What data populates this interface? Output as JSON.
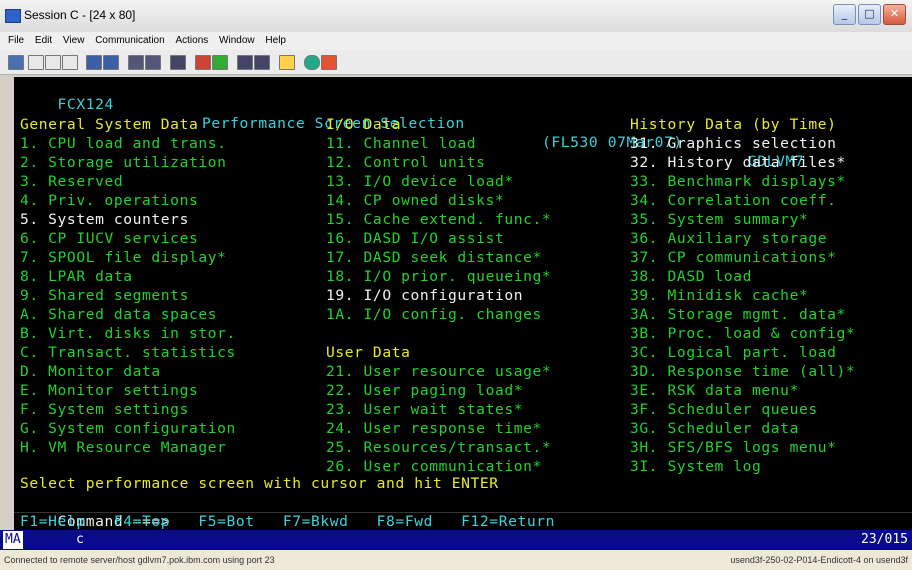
{
  "window": {
    "title": "Session C - [24 x 80]",
    "buttons": [
      "_",
      "□",
      "✕"
    ]
  },
  "menu": [
    "File",
    "Edit",
    "View",
    "Communication",
    "Actions",
    "Window",
    "Help"
  ],
  "screen": {
    "header": {
      "panel_id": "FCX124",
      "title": "Performance Screen Selection",
      "version": "(FL530 07Mar07)",
      "system": "GDLVM7"
    },
    "col1": {
      "heading": "General System Data",
      "items": [
        "1. CPU load and trans.",
        "2. Storage utilization",
        "3. Reserved",
        "4. Priv. operations",
        "5. System counters",
        "6. CP IUCV services",
        "7. SPOOL file display*",
        "8. LPAR data",
        "9. Shared segments",
        "A. Shared data spaces",
        "B. Virt. disks in stor.",
        "C. Transact. statistics",
        "D. Monitor data",
        "E. Monitor settings",
        "F. System settings",
        "G. System configuration",
        "H. VM Resource Manager"
      ]
    },
    "col2": {
      "heading": "I/O Data",
      "items": [
        "11. Channel load",
        "12. Control units",
        "13. I/O device load*",
        "14. CP owned disks*",
        "15. Cache extend. func.*",
        "16. DASD I/O assist",
        "17. DASD seek distance*",
        "18. I/O prior. queueing*",
        "19. I/O configuration",
        "1A. I/O config. changes"
      ],
      "user_heading": "User Data",
      "user_items": [
        "21. User resource usage*",
        "22. User paging load*",
        "23. User wait states*",
        "24. User response time*",
        "25. Resources/transact.*",
        "26. User communication*"
      ]
    },
    "col3": {
      "heading": "History Data (by Time)",
      "items": [
        "31. Graphics selection",
        "32. History data files*",
        "33. Benchmark displays*",
        "34. Correlation coeff.",
        "35. System summary*",
        "36. Auxiliary storage",
        "37. CP communications*",
        "38. DASD load",
        "39. Minidisk cache*",
        "3A. Storage mgmt. data*",
        "3B. Proc. load & config*",
        "3C. Logical part. load",
        "3D. Response time (all)*",
        "3E. RSK data menu*",
        "3F. Scheduler queues",
        "3G. Scheduler data",
        "3H. SFS/BFS logs menu*",
        "3I. System log"
      ]
    },
    "prompt": "Select performance screen with cursor and hit ENTER",
    "command_label": "Command ===>",
    "pfkeys": "F1=Help   F4=Top   F5=Bot   F7=Bkwd   F8=Fwd   F12=Return"
  },
  "oia": {
    "indicator": "MA",
    "session": "c",
    "cursor_pos": "23/015"
  },
  "statusbar": {
    "left": "Connected to remote server/host gdlvm7.pok.ibm.com using port 23",
    "right": "usend3f-250-02-P014-Endicott-4 on usend3f"
  },
  "colors": {
    "terminal_bg": "#000000",
    "green": "#22d22c",
    "turquoise": "#3ad3dc",
    "white": "#f2f2f2",
    "oia_bg": "#0a0a8c"
  }
}
